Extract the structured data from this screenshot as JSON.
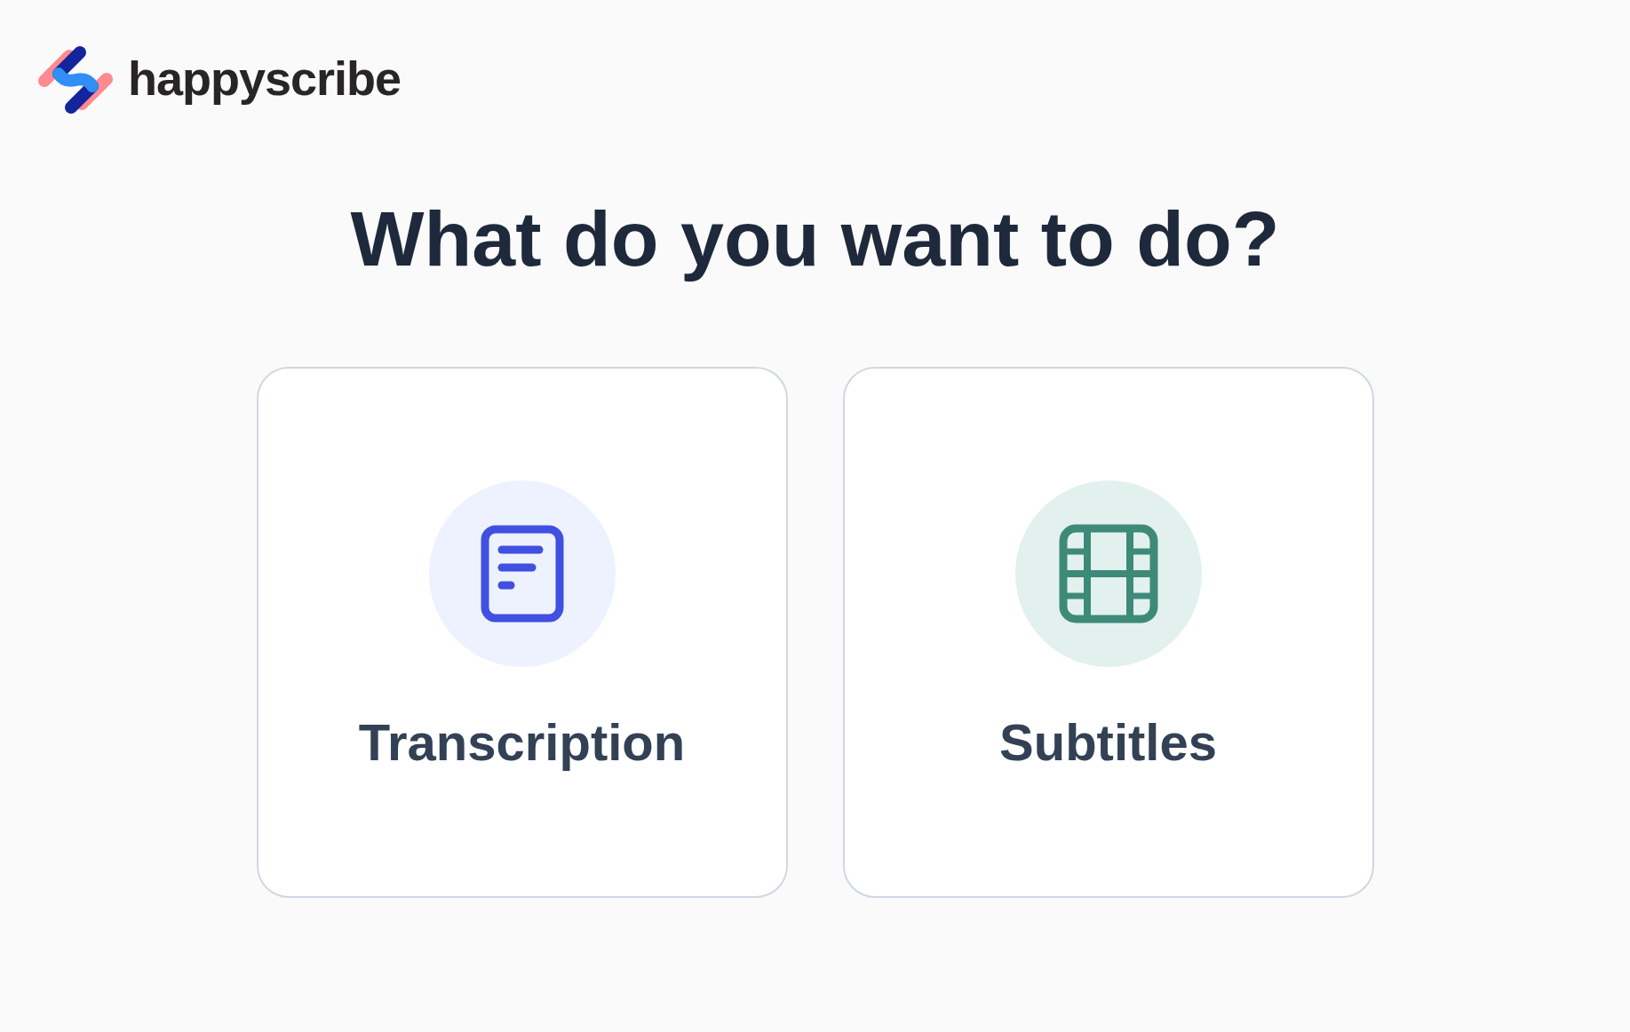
{
  "logo": {
    "text": "happyscribe"
  },
  "heading": "What do you want to do?",
  "options": [
    {
      "label": "Transcription",
      "kind": "document"
    },
    {
      "label": "Subtitles",
      "kind": "film"
    }
  ]
}
